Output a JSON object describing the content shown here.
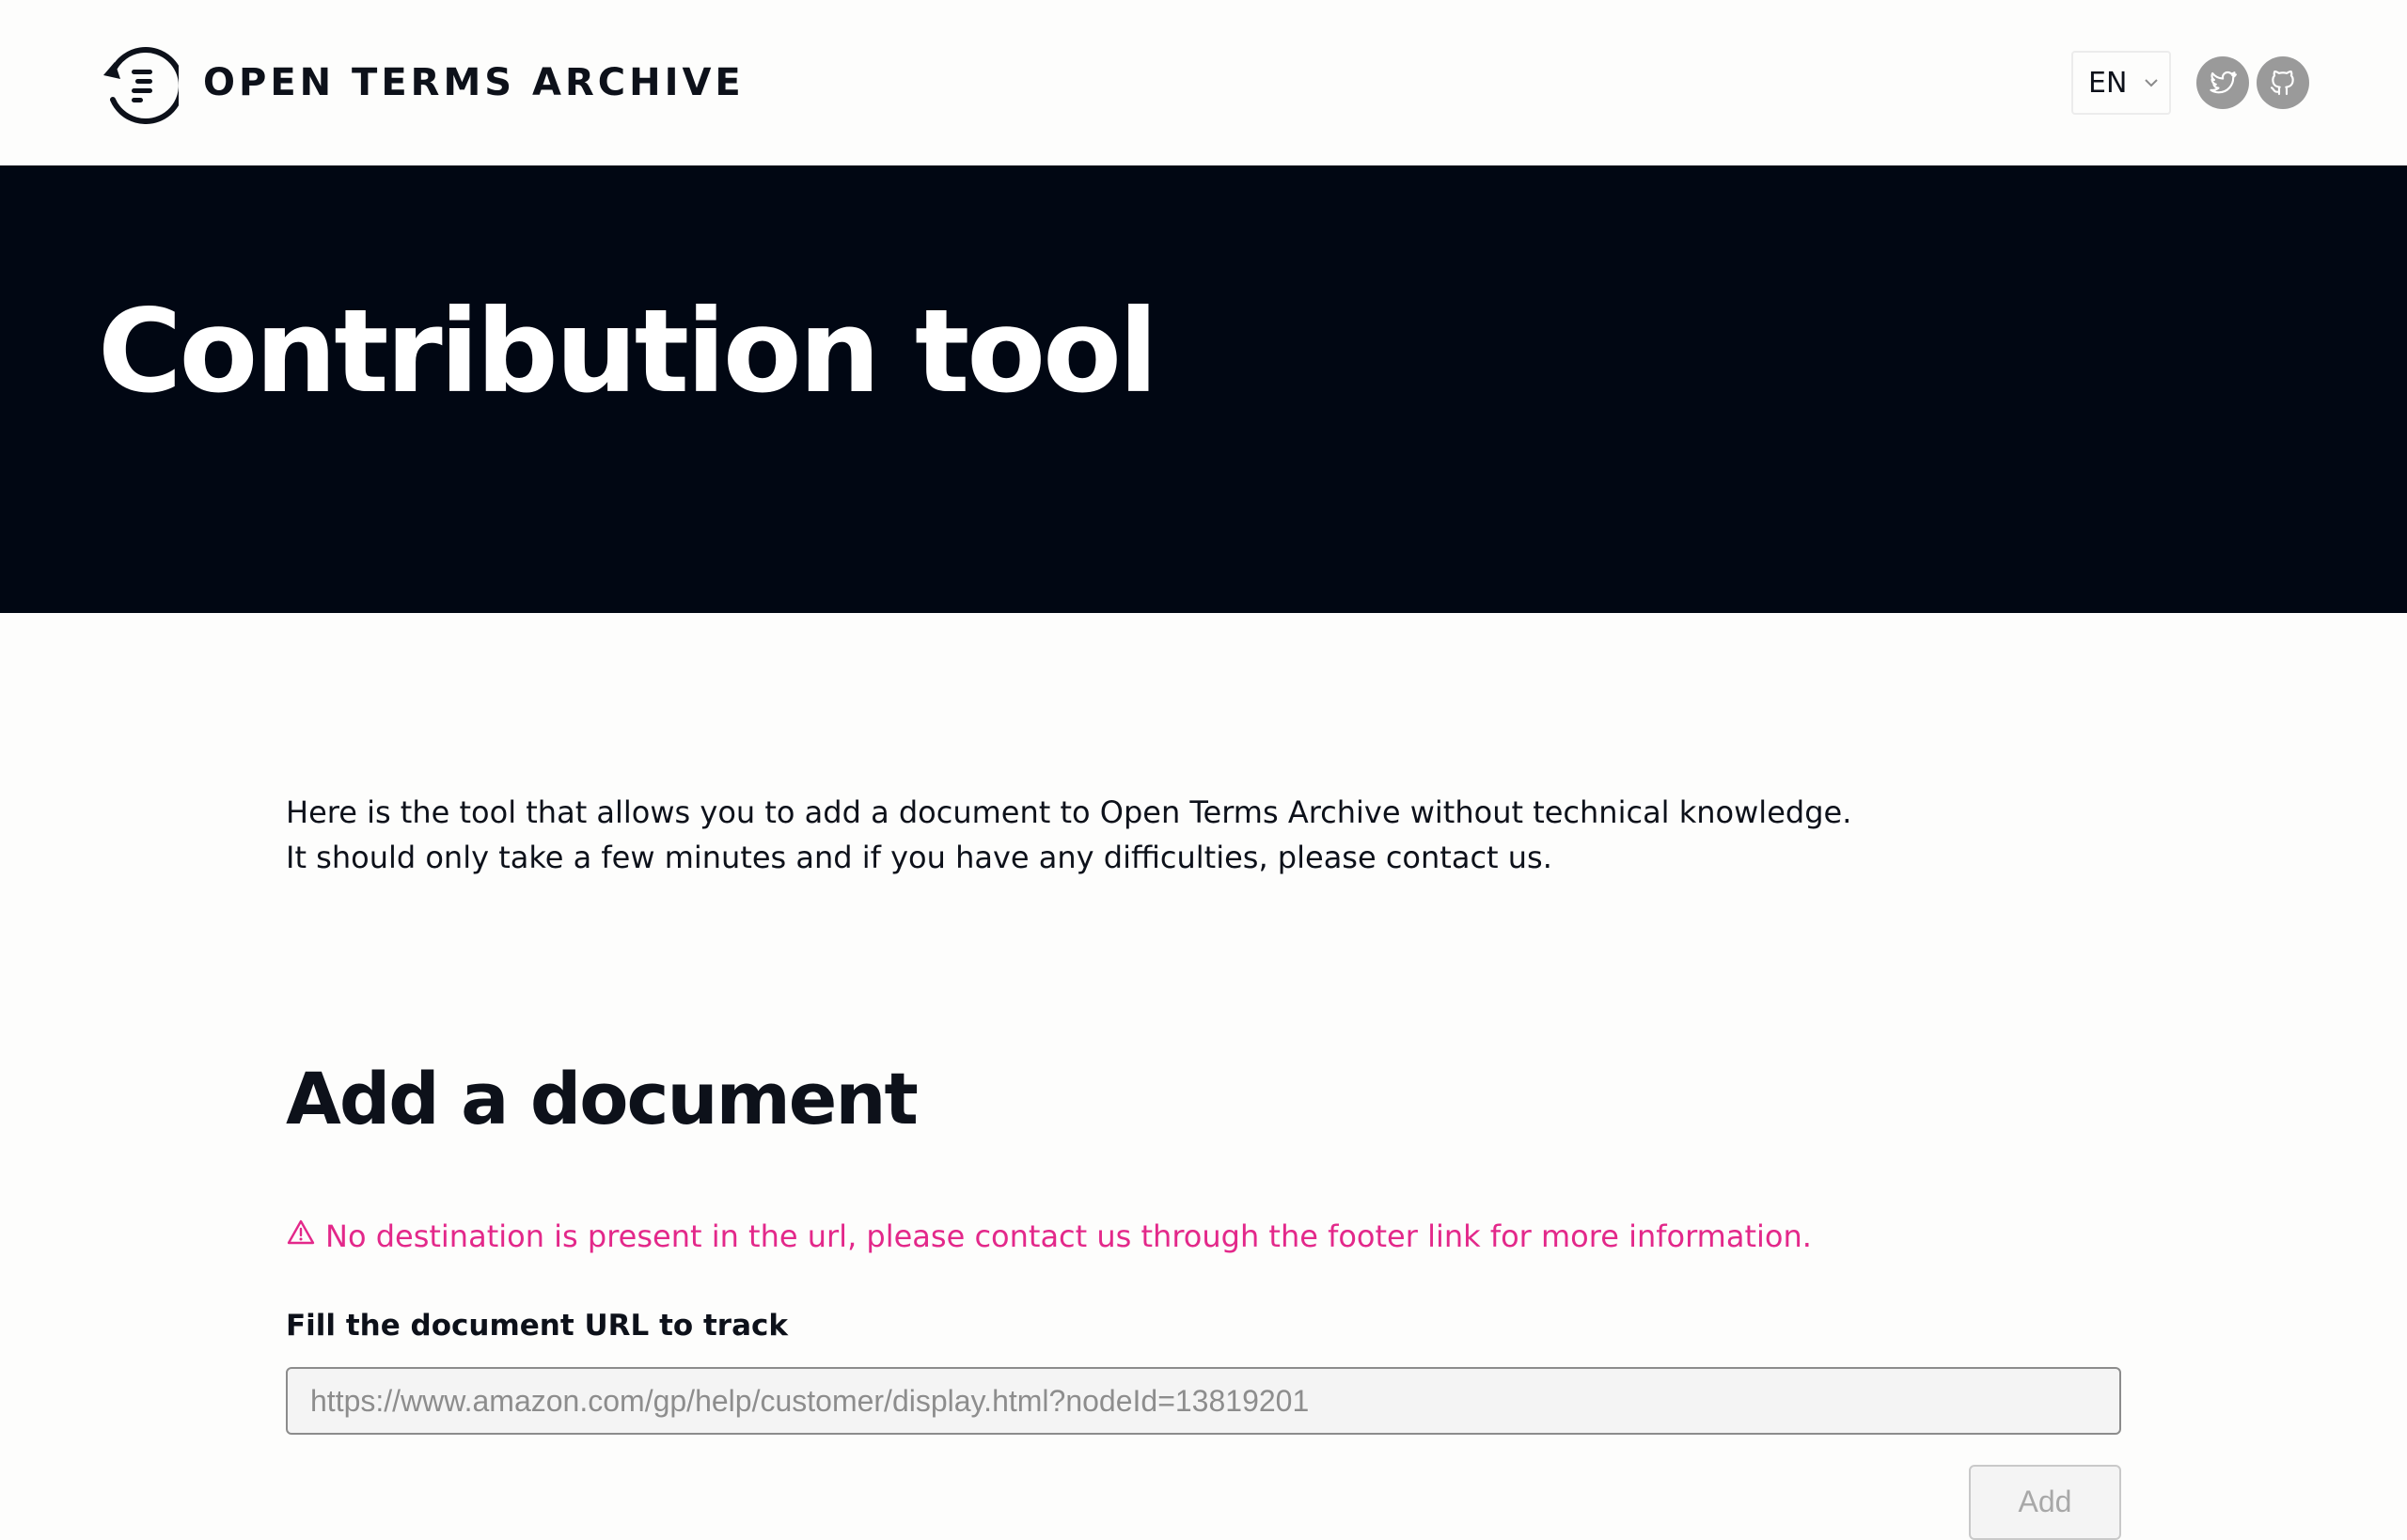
{
  "header": {
    "brand_name": "OPEN TERMS ARCHIVE",
    "language_selector": {
      "selected": "EN"
    },
    "social_links": [
      {
        "icon": "twitter-icon"
      },
      {
        "icon": "github-icon"
      }
    ]
  },
  "hero": {
    "title": "Contribution tool"
  },
  "intro": {
    "line_1": "Here is the tool that allows you to add a document to Open Terms Archive without technical knowledge.",
    "line_2": "It should only take a few minutes and if you have any difficulties, please contact us."
  },
  "form": {
    "section_title": "Add a document",
    "warning": "No destination is present in the url, please contact us through the footer link for more information.",
    "url_label": "Fill the document URL to track",
    "url_placeholder": "https://www.amazon.com/gp/help/customer/display.html?nodeId=13819201",
    "url_value": "",
    "submit_label": "Add"
  },
  "colors": {
    "hero_background": "#010713",
    "warning": "#e3288a",
    "text": "#0d111a"
  }
}
